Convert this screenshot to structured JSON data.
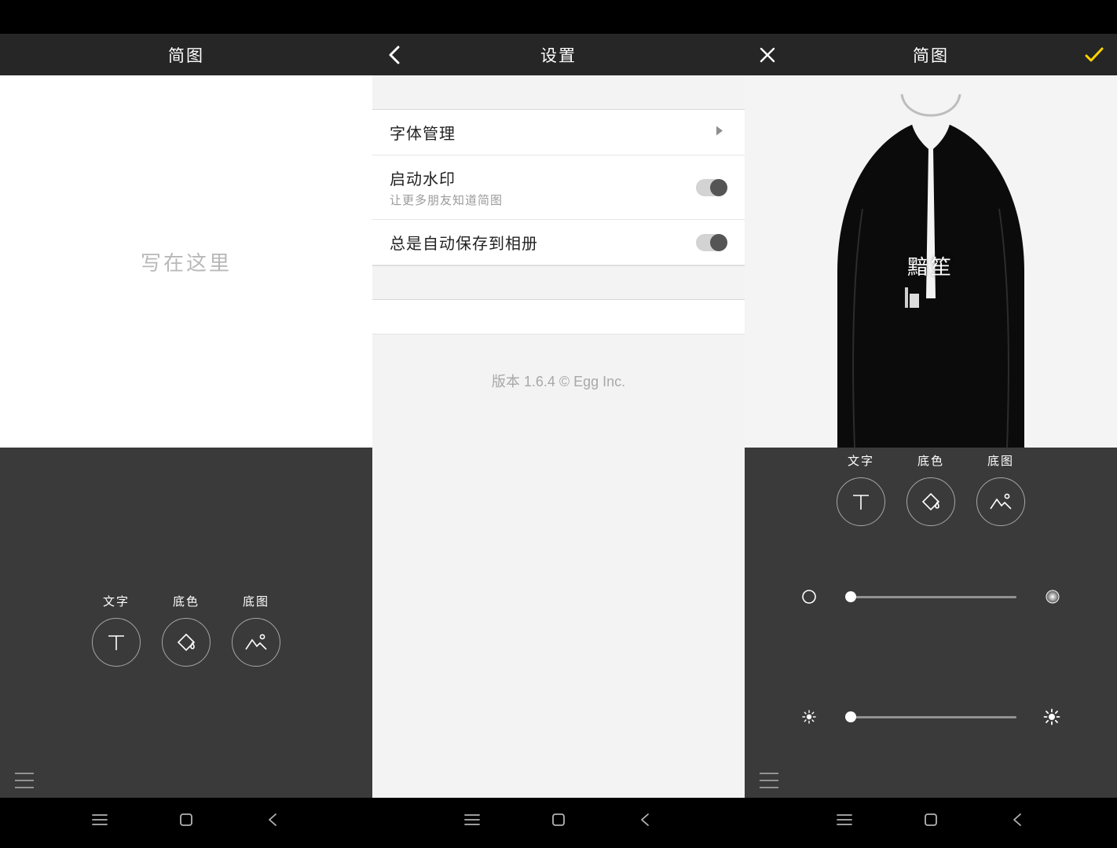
{
  "pane1": {
    "title": "简图",
    "placeholder": "写在这里",
    "tools": [
      {
        "label": "文字",
        "icon": "text-icon"
      },
      {
        "label": "底色",
        "icon": "bg-color-icon"
      },
      {
        "label": "底图",
        "icon": "bg-image-icon"
      }
    ]
  },
  "pane2": {
    "title": "设置",
    "font_mgmt": {
      "title": "字体管理"
    },
    "watermark": {
      "title": "启动水印",
      "sub": "让更多朋友知道简图",
      "on": true
    },
    "autosave": {
      "title": "总是自动保存到相册",
      "on": true
    },
    "version_line": "版本 1.6.4    © Egg Inc."
  },
  "pane3": {
    "title": "简图",
    "overlay_text": "黯笙",
    "tools": [
      {
        "label": "文字",
        "icon": "text-icon"
      },
      {
        "label": "底色",
        "icon": "bg-color-icon"
      },
      {
        "label": "底图",
        "icon": "bg-image-icon"
      }
    ],
    "slider_blur_pct": 3,
    "slider_brightness_pct": 3
  }
}
